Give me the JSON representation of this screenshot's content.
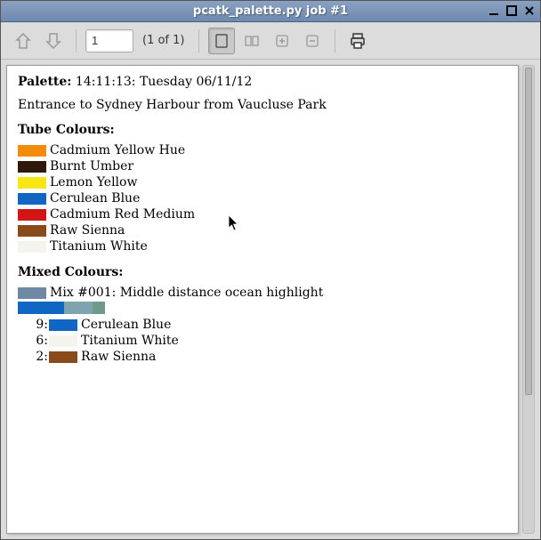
{
  "window": {
    "title": "pcatk_palette.py job #1"
  },
  "toolbar": {
    "page_value": "1",
    "page_label": "(1 of 1)"
  },
  "palette": {
    "label": "Palette:",
    "timestamp": "14:11:13: Tuesday 06/11/12",
    "title": "Entrance to Sydney Harbour from Vaucluse Park"
  },
  "tube": {
    "heading": "Tube Colours:",
    "items": [
      {
        "name": "Cadmium Yellow Hue",
        "color": "#f28c0a"
      },
      {
        "name": "Burnt Umber",
        "color": "#2d1a0a"
      },
      {
        "name": "Lemon Yellow",
        "color": "#f7e516"
      },
      {
        "name": "Cerulean Blue",
        "color": "#1166c4"
      },
      {
        "name": "Cadmium Red Medium",
        "color": "#d21616"
      },
      {
        "name": "Raw Sienna",
        "color": "#8a4b1a"
      },
      {
        "name": "Titanium White",
        "color": "#f5f3ee"
      }
    ]
  },
  "mixed": {
    "heading": "Mixed Colours:",
    "mix": {
      "label": "Mix #001: Middle distance ocean highlight",
      "swatch": "#6f89a5",
      "gradient": [
        {
          "color": "#1166c4",
          "w": 52
        },
        {
          "color": "#7fa4b0",
          "w": 32
        },
        {
          "color": "#6d9a8d",
          "w": 14
        }
      ],
      "parts": [
        {
          "ratio": "9:",
          "color": "#1166c4",
          "name": "Cerulean Blue"
        },
        {
          "ratio": "6:",
          "color": "#f5f3ee",
          "name": "Titanium White"
        },
        {
          "ratio": "2:",
          "color": "#8a4b1a",
          "name": "Raw Sienna"
        }
      ]
    }
  }
}
